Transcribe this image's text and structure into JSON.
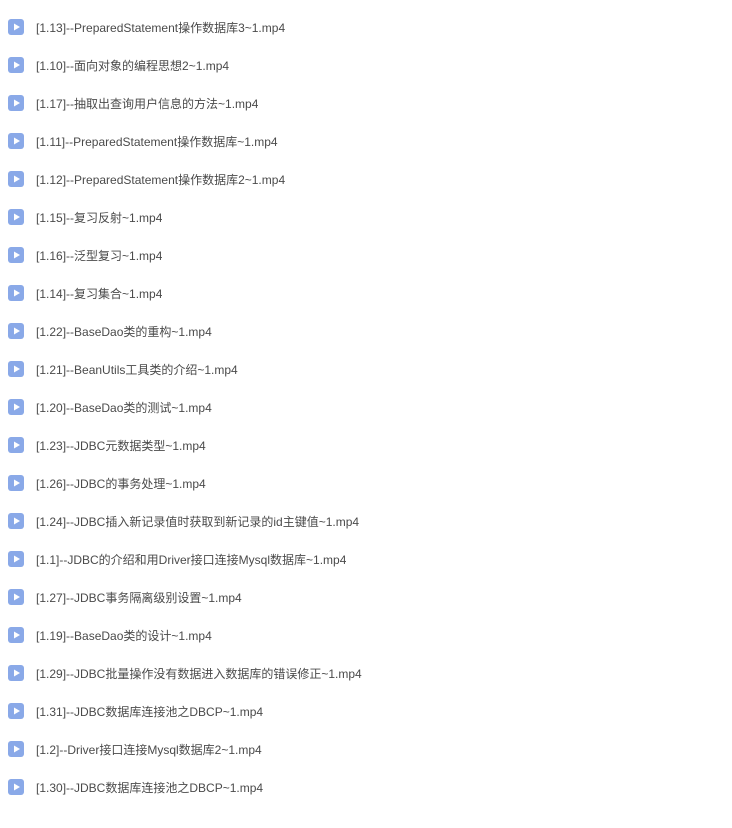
{
  "files": [
    {
      "name": "[1.13]--PreparedStatement操作数据库3~1.mp4"
    },
    {
      "name": "[1.10]--面向对象的编程思想2~1.mp4"
    },
    {
      "name": "[1.17]--抽取出查询用户信息的方法~1.mp4"
    },
    {
      "name": "[1.11]--PreparedStatement操作数据库~1.mp4"
    },
    {
      "name": "[1.12]--PreparedStatement操作数据库2~1.mp4"
    },
    {
      "name": "[1.15]--复习反射~1.mp4"
    },
    {
      "name": "[1.16]--泛型复习~1.mp4"
    },
    {
      "name": "[1.14]--复习集合~1.mp4"
    },
    {
      "name": "[1.22]--BaseDao类的重构~1.mp4"
    },
    {
      "name": "[1.21]--BeanUtils工具类的介绍~1.mp4"
    },
    {
      "name": "[1.20]--BaseDao类的测试~1.mp4"
    },
    {
      "name": "[1.23]--JDBC元数据类型~1.mp4"
    },
    {
      "name": "[1.26]--JDBC的事务处理~1.mp4"
    },
    {
      "name": "[1.24]--JDBC插入新记录值时获取到新记录的id主键值~1.mp4"
    },
    {
      "name": "[1.1]--JDBC的介绍和用Driver接口连接Mysql数据库~1.mp4"
    },
    {
      "name": "[1.27]--JDBC事务隔离级别设置~1.mp4"
    },
    {
      "name": "[1.19]--BaseDao类的设计~1.mp4"
    },
    {
      "name": "[1.29]--JDBC批量操作没有数据进入数据库的错误修正~1.mp4"
    },
    {
      "name": "[1.31]--JDBC数据库连接池之DBCP~1.mp4"
    },
    {
      "name": "[1.2]--Driver接口连接Mysql数据库2~1.mp4"
    },
    {
      "name": "[1.30]--JDBC数据库连接池之DBCP~1.mp4"
    }
  ],
  "iconColors": {
    "bg": "#8aa9e8",
    "triangle": "#ffffff"
  }
}
